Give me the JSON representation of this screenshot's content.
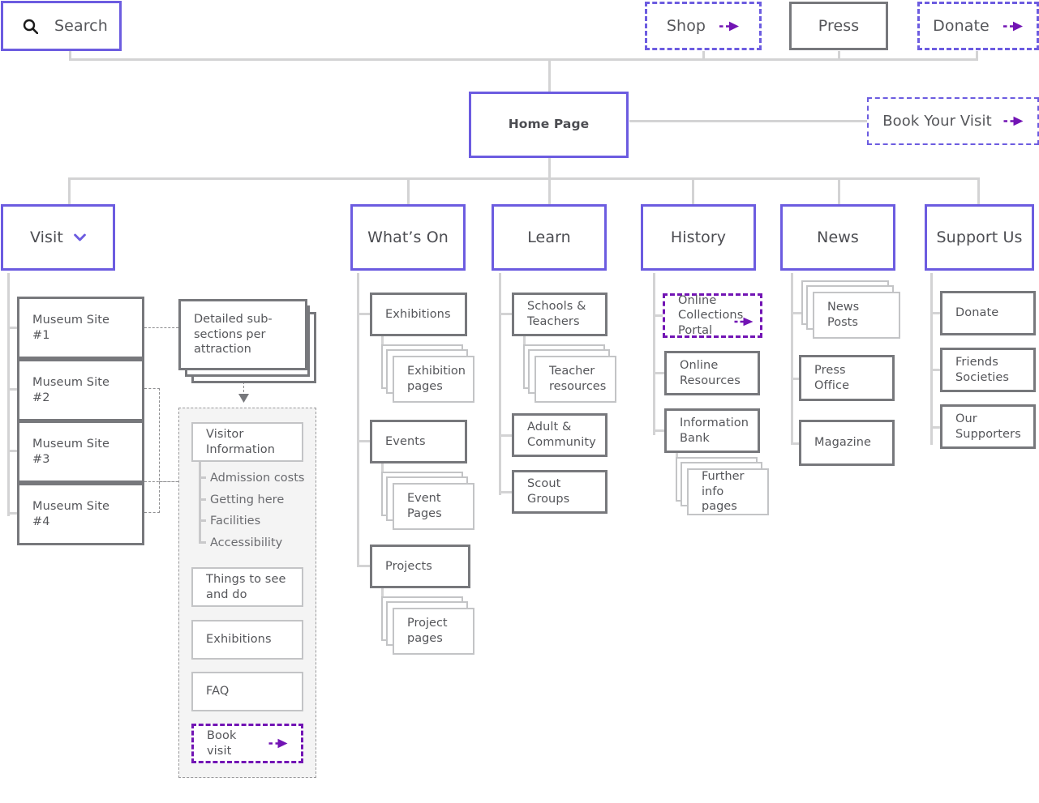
{
  "colors": {
    "accent_blue_purple": "#6c5ce0",
    "accent_deep_purple": "#7214b4",
    "box_grey": "#77787c",
    "box_grey_light": "#c3c4c6",
    "connector_grey": "#d3d3d4",
    "panel_bg": "#f4f4f4",
    "text": "#55565a"
  },
  "utility_nav": {
    "search": {
      "label": "Search",
      "icon": "search-icon"
    },
    "shop": {
      "label": "Shop",
      "icon": "external-arrow-icon"
    },
    "press": {
      "label": "Press"
    },
    "donate": {
      "label": "Donate",
      "icon": "external-arrow-icon"
    }
  },
  "home": {
    "label": "Home Page"
  },
  "book_your_visit": {
    "label": "Book Your Visit",
    "icon": "external-arrow-icon"
  },
  "main_nav": [
    {
      "label": "Visit",
      "icon": "chevron-down-icon"
    },
    {
      "label": "What’s On"
    },
    {
      "label": "Learn"
    },
    {
      "label": "History"
    },
    {
      "label": "News"
    },
    {
      "label": "Support Us"
    }
  ],
  "visit": {
    "sites": [
      {
        "label": "Museum Site #1"
      },
      {
        "label": "Museum Site #2"
      },
      {
        "label": "Museum Site #3"
      },
      {
        "label": "Museum Site #4"
      }
    ],
    "detailed": {
      "label": "Detailed sub-sections per attraction"
    },
    "panel": {
      "visitor_information": {
        "label": "Visitor Information"
      },
      "visitor_sublinks": [
        {
          "label": "Admission costs"
        },
        {
          "label": "Getting here"
        },
        {
          "label": "Facilities"
        },
        {
          "label": "Accessibility"
        }
      ],
      "things_to_see": {
        "label": "Things to see and do"
      },
      "exhibitions": {
        "label": "Exhibitions"
      },
      "faq": {
        "label": "FAQ"
      },
      "book_visit": {
        "label": "Book visit",
        "icon": "external-arrow-icon"
      }
    }
  },
  "whats_on": {
    "exhibitions": {
      "label": "Exhibitions"
    },
    "exhibition_pages": {
      "label": "Exhibition pages"
    },
    "events": {
      "label": "Events"
    },
    "event_pages": {
      "label": "Event Pages"
    },
    "projects": {
      "label": "Projects"
    },
    "project_pages": {
      "label": "Project pages"
    }
  },
  "learn": {
    "schools_teachers": {
      "label": "Schools & Teachers"
    },
    "teacher_resources": {
      "label": "Teacher resources"
    },
    "adult_community": {
      "label": "Adult & Community"
    },
    "scout_groups": {
      "label": "Scout Groups"
    }
  },
  "history": {
    "online_collections_portal": {
      "label": "Online Collections Portal",
      "icon": "external-arrow-icon"
    },
    "online_resources": {
      "label": "Online Resources"
    },
    "information_bank": {
      "label": "Information Bank"
    },
    "further_info_pages": {
      "label": "Further info pages"
    }
  },
  "news": {
    "news_posts": {
      "label": "News Posts"
    },
    "press_office": {
      "label": "Press Office"
    },
    "magazine": {
      "label": "Magazine"
    }
  },
  "support_us": {
    "donate": {
      "label": "Donate"
    },
    "friends_societies": {
      "label": "Friends Societies"
    },
    "our_supporters": {
      "label": "Our Supporters"
    }
  }
}
